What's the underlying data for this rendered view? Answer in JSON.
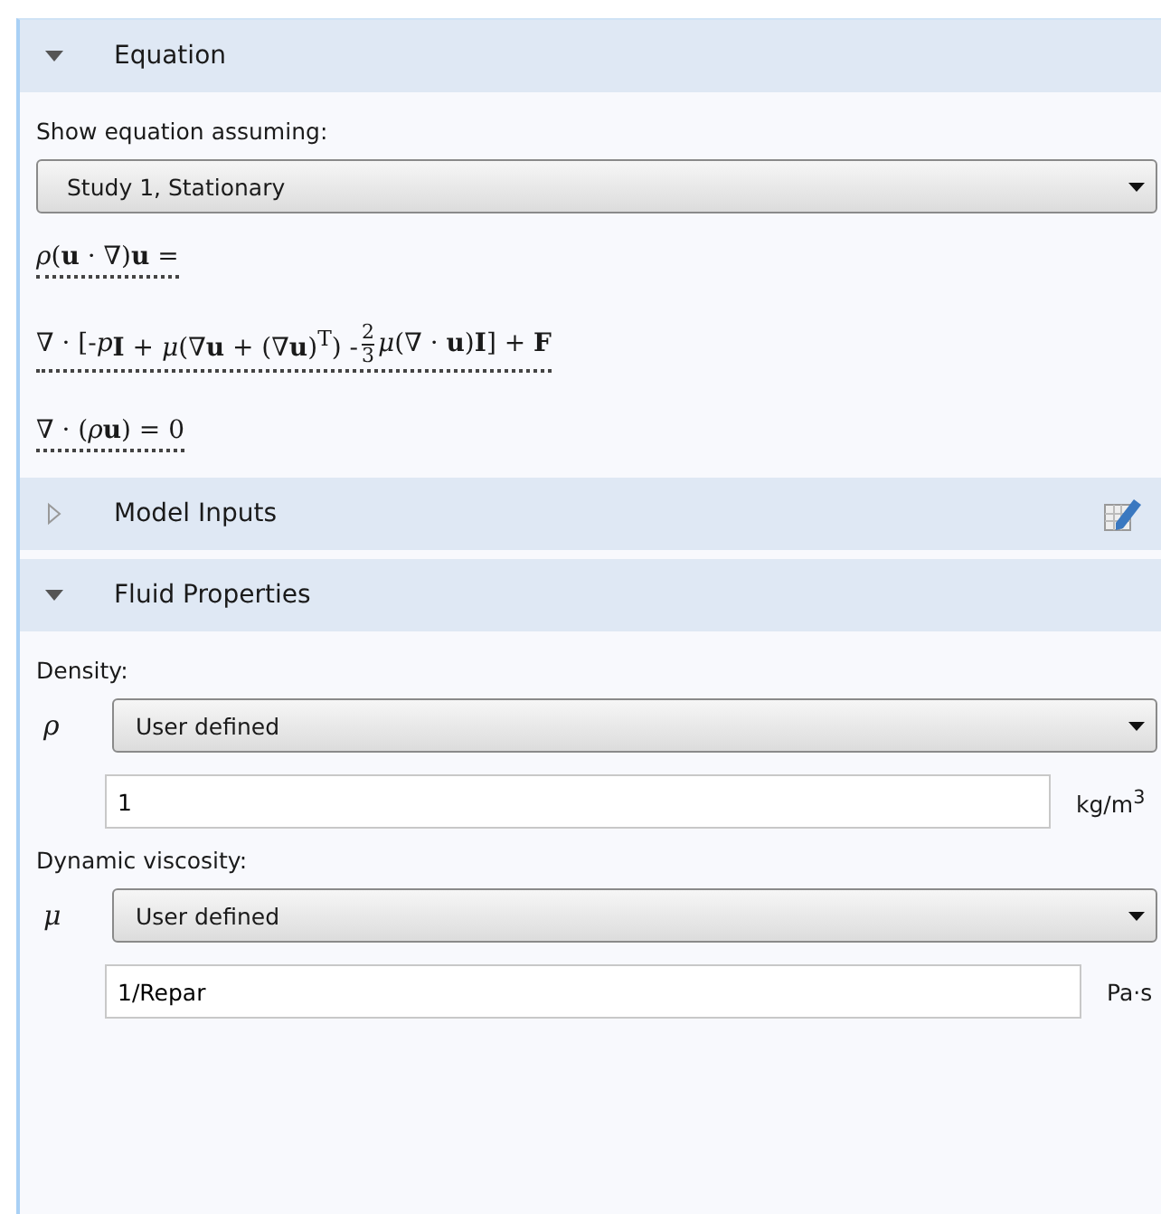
{
  "sections": [
    {
      "title": "Equation",
      "expanded": true,
      "kind": "equation",
      "label": "Show equation assuming:",
      "select": "Study 1, Stationary",
      "equations": [
        [
          {
            "kind": "text",
            "text": "*ρ*(**u** · ∇)**u** ="
          }
        ],
        [
          {
            "kind": "text",
            "text": "∇ · [-*p*"
          },
          {
            "kind": "text",
            "text": "**I** + *μ*(∇**u** + (∇**u**)$^{T}$) - "
          },
          {
            "kind": "frac",
            "num": "2",
            "den": "3"
          },
          {
            "kind": "text",
            "text": "*μ*(∇ · **u**)**I**] + **F**"
          }
        ],
        [
          {
            "kind": "text",
            "text": "∇ · (*ρ*"
          },
          {
            "kind": "text",
            "text": "**u**) = 0"
          }
        ]
      ]
    },
    {
      "title": "Model Inputs",
      "expanded": false,
      "edit_icon": true
    },
    {
      "title": "Fluid Properties",
      "expanded": true,
      "kind": "properties",
      "properties": [
        {
          "label": "Density:",
          "symbol": "ρ",
          "select": "User defined",
          "value": "1",
          "unit": "kg/m$^{3}$"
        },
        {
          "label": "Dynamic viscosity:",
          "symbol": "μ",
          "select": "User defined",
          "value": "1/Repar",
          "unit": "Pa·s"
        }
      ]
    }
  ]
}
